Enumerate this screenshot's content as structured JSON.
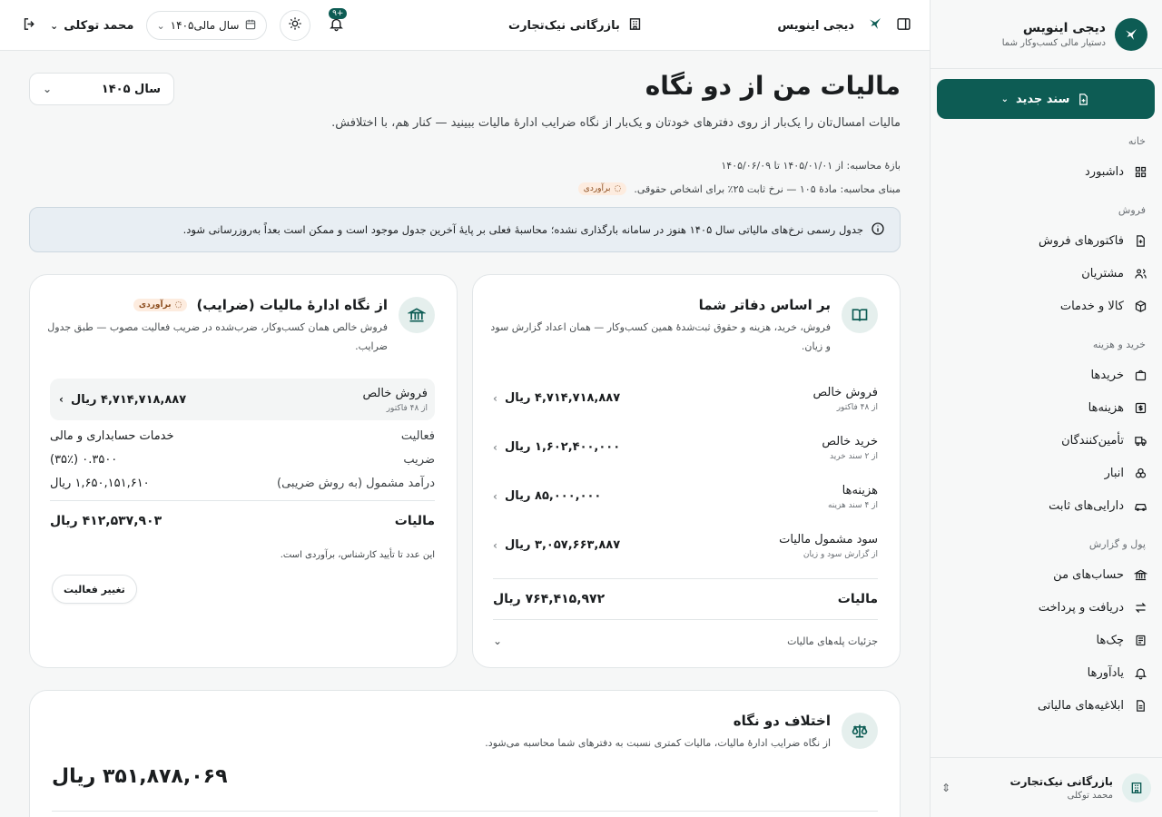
{
  "brand": {
    "name": "دیجی اینویس",
    "subtitle": "دستیار مالی کسب‌وکار شما"
  },
  "sidebar": {
    "new_doc": "سند جدید",
    "groups": [
      {
        "title": "خانه",
        "items": [
          {
            "label": "داشبورد",
            "icon": "grid-icon"
          }
        ]
      },
      {
        "title": "فروش",
        "items": [
          {
            "label": "فاکتورهای فروش",
            "icon": "invoice-icon"
          },
          {
            "label": "مشتریان",
            "icon": "users-icon"
          },
          {
            "label": "کالا و خدمات",
            "icon": "box-icon"
          }
        ]
      },
      {
        "title": "خرید و هزینه",
        "items": [
          {
            "label": "خریدها",
            "icon": "bag-icon"
          },
          {
            "label": "هزینه‌ها",
            "icon": "dollar-icon"
          },
          {
            "label": "تأمین‌کنندگان",
            "icon": "truck-icon"
          },
          {
            "label": "انبار",
            "icon": "boxes-icon"
          },
          {
            "label": "دارایی‌های ثابت",
            "icon": "car-icon"
          }
        ]
      },
      {
        "title": "پول و گزارش",
        "items": [
          {
            "label": "حساب‌های من",
            "icon": "bank-icon"
          },
          {
            "label": "دریافت و پرداخت",
            "icon": "swap-icon"
          },
          {
            "label": "چک‌ها",
            "icon": "cheque-icon"
          },
          {
            "label": "یادآورها",
            "icon": "bell-icon"
          },
          {
            "label": "ابلاغیه‌های مالیاتی",
            "icon": "document-icon"
          }
        ]
      }
    ],
    "company": {
      "name": "بازرگانی نیک‌تجارت",
      "user": "محمد توکلی"
    }
  },
  "topbar": {
    "app_name": "دیجی اینویس",
    "company": "بازرگانی نیک‌تجارت",
    "fiscal_year": "سال مالی۱۴۰۵",
    "notif_count": "۹+",
    "user": "محمد توکلی"
  },
  "page": {
    "title": "مالیات من از دو نگاه",
    "year_select": "سال ۱۴۰۵",
    "subtitle": "مالیات امسال‌تان را یک‌بار از روی دفترهای خودتان و یک‌بار از نگاه ضرایب ادارهٔ مالیات ببینید — کنار هم، با اختلافش.",
    "period": "بازهٔ محاسبه: از ۱۴۰۵/۰۱/۰۱ تا ۱۴۰۵/۰۶/۰۹",
    "basis": "مبنای محاسبه: مادهٔ ۱۰۵ — نرخ ثابت ۲۵٪ برای اشخاص حقوقی.",
    "estimate_badge": "برآوردی",
    "info": "جدول رسمی نرخ‌های مالیاتی سال ۱۴۰۵ هنوز در سامانه بارگذاری نشده؛ محاسبهٔ فعلی بر پایهٔ آخرین جدول موجود است و ممکن است بعداً به‌روزرسانی شود."
  },
  "books_card": {
    "title": "بر اساس دفاتر شما",
    "desc": "فروش، خرید، هزینه و حقوق ثبت‌شدهٔ همین کسب‌وکار — همان اعداد گزارش سود و زیان.",
    "rows": [
      {
        "label": "فروش خالص",
        "sub": "از ۴۸ فاکتور",
        "value": "۴,۷۱۴,۷۱۸,۸۸۷ ریال"
      },
      {
        "label": "خرید خالص",
        "sub": "از ۲ سند خرید",
        "value": "۱,۶۰۲,۴۰۰,۰۰۰ ریال"
      },
      {
        "label": "هزینه‌ها",
        "sub": "از ۴ سند هزینه",
        "value": "۸۵,۰۰۰,۰۰۰ ریال"
      },
      {
        "label": "سود مشمول مالیات",
        "sub": "از گزارش سود و زیان",
        "value": "۳,۰۵۷,۶۶۳,۸۸۷ ریال"
      }
    ],
    "total_label": "مالیات",
    "total_value": "۷۶۴,۴۱۵,۹۷۲ ریال",
    "details": "جزئیات پله‌های مالیات"
  },
  "gov_card": {
    "title": "از نگاه ادارهٔ مالیات (ضرایب)",
    "badge": "برآوردی",
    "desc": "فروش خالص همان کسب‌وکار، ضرب‌شده در ضریب فعالیت مصوب — طبق جدول ضرایب.",
    "net_sales_label": "فروش خالص",
    "net_sales_sub": "از ۴۸ فاکتور",
    "net_sales_value": "۴,۷۱۴,۷۱۸,۸۸۷ ریال",
    "rows": [
      {
        "label": "فعالیت",
        "value": "خدمات حسابداری و مالی"
      },
      {
        "label": "ضریب",
        "value": "۰.۳۵۰۰ (۳۵٪)"
      },
      {
        "label": "درآمد مشمول (به روش ضریبی)",
        "value": "۱,۶۵۰,۱۵۱,۶۱۰ ریال"
      }
    ],
    "total_label": "مالیات",
    "total_value": "۴۱۲,۵۳۷,۹۰۳ ریال",
    "note": "این عدد تا تأیید کارشناس، برآوردی است.",
    "change_btn": "تغییر فعالیت"
  },
  "diff_card": {
    "title": "اختلاف دو نگاه",
    "desc": "از نگاه ضرایب ادارهٔ مالیات، مالیات کمتری نسبت به دفترهای شما محاسبه می‌شود.",
    "value": "۳۵۱,۸۷۸,۰۶۹ ریال"
  },
  "colors": {
    "primary": "#0d5c54",
    "info_bg": "#e8eef3",
    "estimate_bg": "#fdecdf"
  }
}
